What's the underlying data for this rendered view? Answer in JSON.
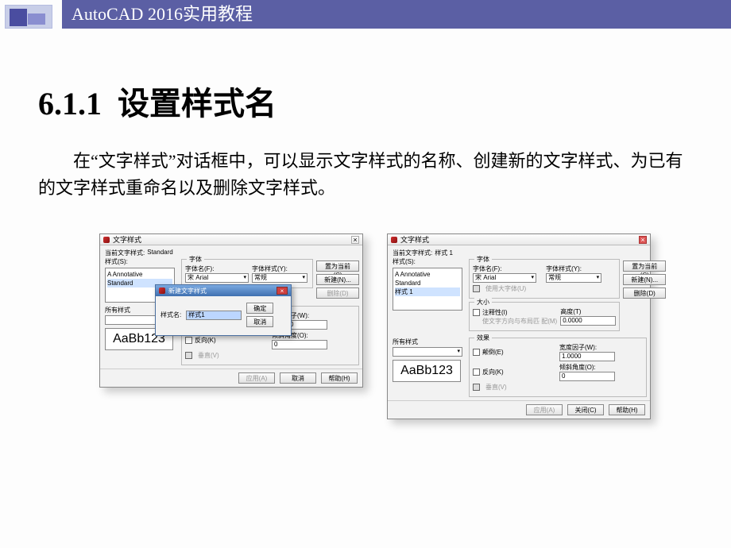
{
  "header": {
    "title": "AutoCAD 2016实用教程"
  },
  "section": {
    "number": "6.1.1",
    "title": "设置样式名"
  },
  "paragraph": "在“文字样式”对话框中，可以显示文字样式的名称、创建新的文字样式、为已有的文字样式重命名以及删除文字样式。",
  "dlg_common": {
    "title": "文字样式",
    "cur_style_lbl": "当前文字样式:",
    "styles_lbl": "样式(S):",
    "all_styles_lbl": "所有样式",
    "preview_text": "AaBb123",
    "font_group": "字体",
    "font_name_lbl": "字体名(F):",
    "font_name_val": "宋 Arial",
    "font_style_lbl": "字体样式(Y):",
    "font_style_val": "常规",
    "use_big_font": "使用大字体(U)",
    "size_group": "大小",
    "annotative": "注释性(I)",
    "match_orient": "使文字方向与布局匹\n配(M)",
    "height_lbl": "高度(T)",
    "height_val": "0.0000",
    "effects_group": "效果",
    "upside": "颠倒(E)",
    "backwards": "反向(K)",
    "vertical": "垂直(V)",
    "wf_lbl": "宽度因子(W):",
    "wf_val": "1.0000",
    "oa_lbl": "倾斜角度(O):",
    "oa_val": "0",
    "set_current": "置为当前(C)",
    "new_btn": "新建(N)...",
    "delete_btn": "删除(D)",
    "apply": "应用(A)",
    "close": "关闭(C)",
    "cancel": "取消",
    "help": "帮助(H)"
  },
  "left": {
    "current_style": "Standard",
    "list": [
      "A Annotative",
      "Standard"
    ],
    "sub": {
      "title": "新建文字样式",
      "name_lbl": "样式名:",
      "name_val": "样式1",
      "ok": "确定",
      "cancel": "取消"
    }
  },
  "right": {
    "current_style": "样式 1",
    "list": [
      "A Annotative",
      "Standard",
      "样式 1"
    ]
  }
}
